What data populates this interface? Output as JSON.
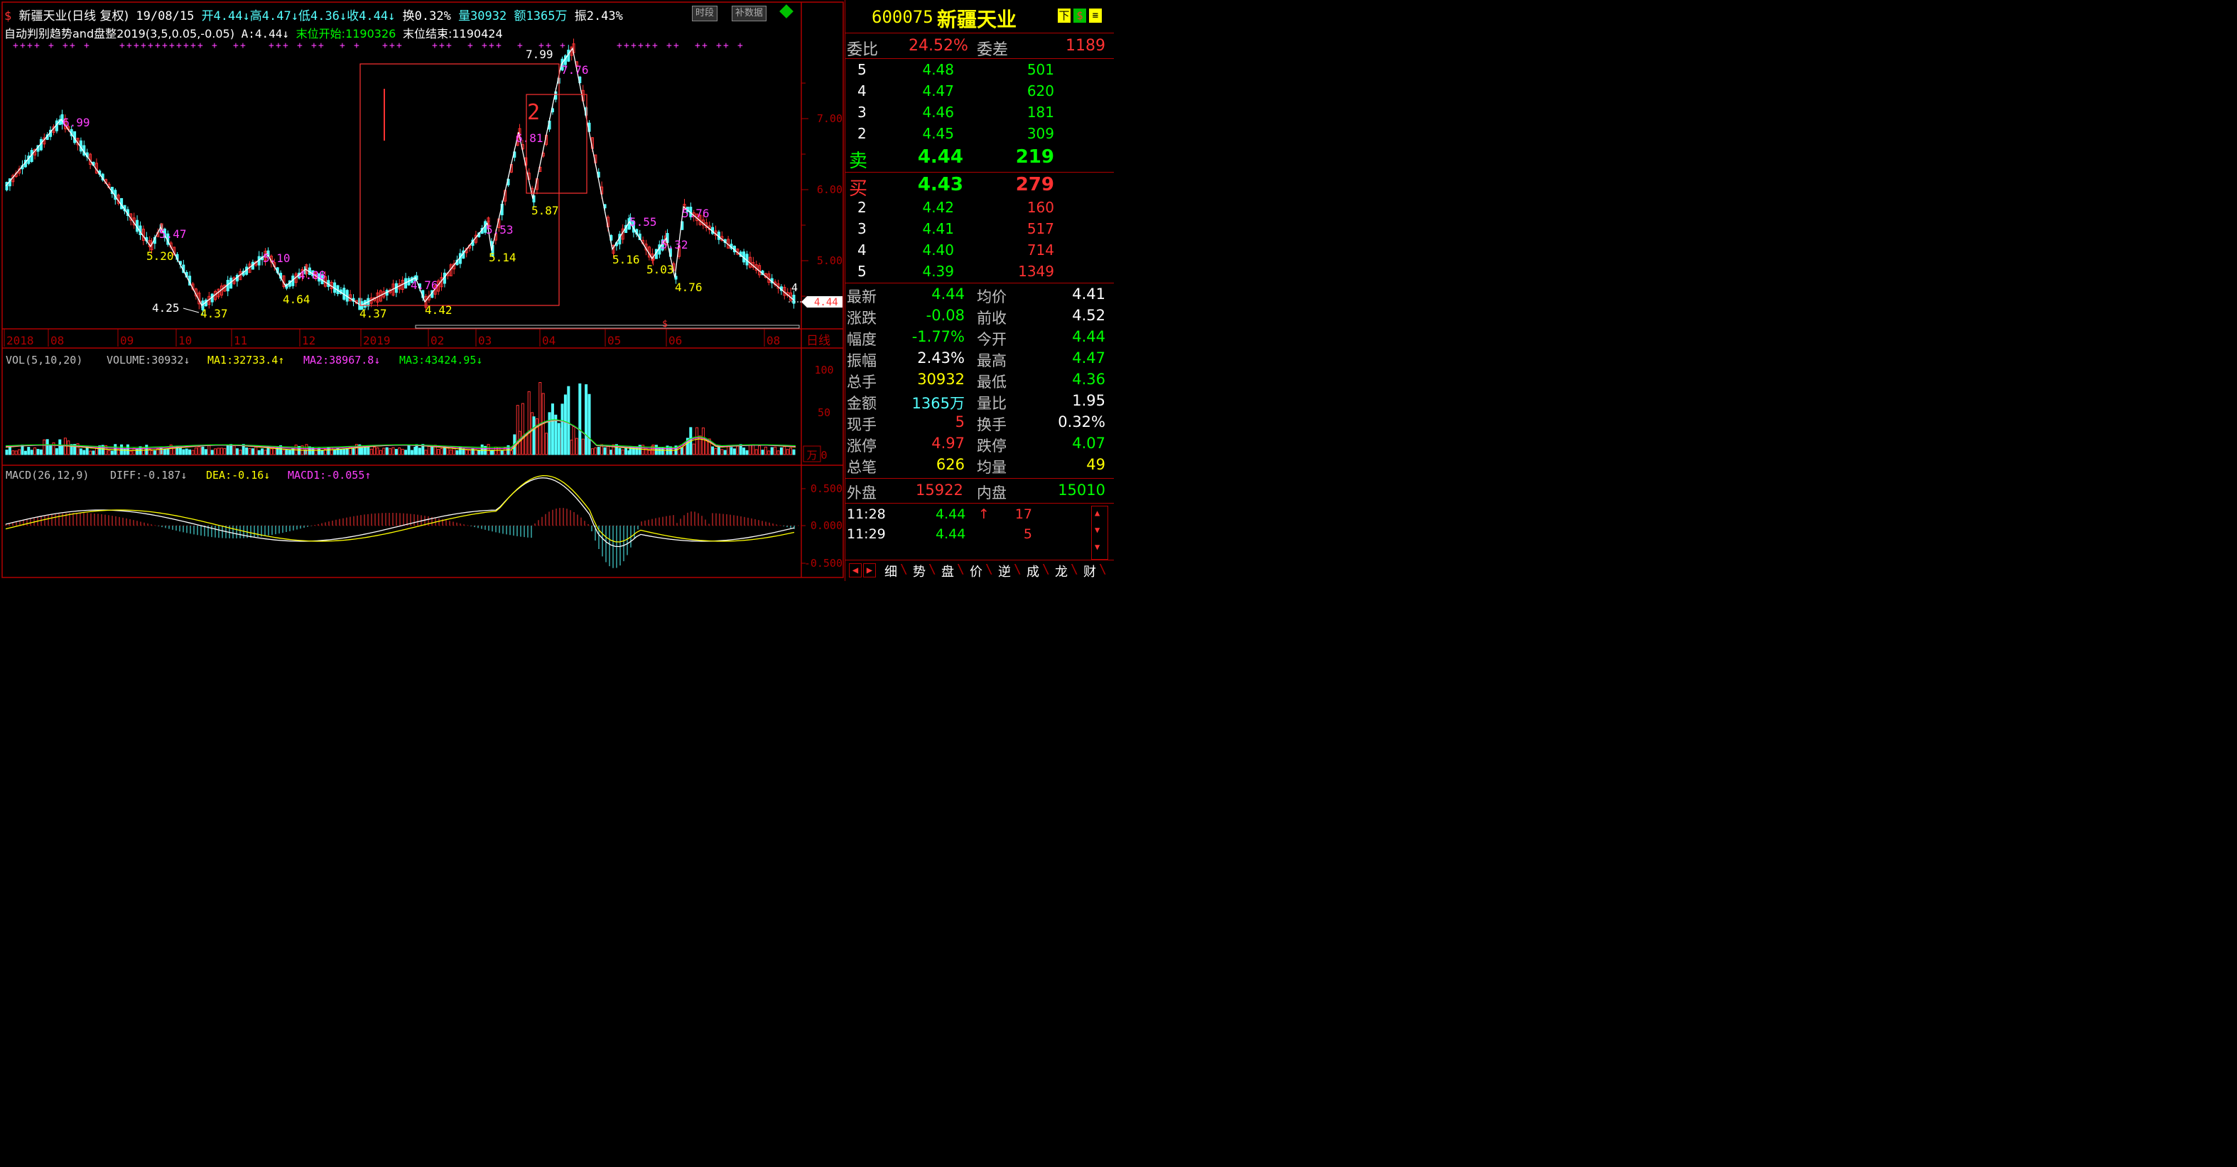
{
  "header": {
    "name": "新疆天业",
    "mode": "(日线 复权)",
    "date": "19/08/15",
    "open": "开4.44",
    "high": "高4.47",
    "low": "低4.36",
    "close": "收4.44",
    "turnover": "换0.32%",
    "volume": "量30932",
    "amount": "额1365万",
    "amplitude": "振2.43%",
    "btn_time": "时段",
    "btn_supp": "补数据",
    "line2_a": "自动判别趋势and盘整2019(3,5,0.05,-0.05)",
    "line2_b": "A:4.44",
    "line2_c": "末位开始:1190326",
    "line2_d": "末位结束:1190424"
  },
  "colors": {
    "up": "#ff3232",
    "down": "#54ffff",
    "magenta": "#ff40ff",
    "yellow": "#ffff00",
    "white": "#ffffff",
    "grid": "#b00000"
  },
  "chart_data": [
    {
      "type": "candlestick",
      "title": "新疆天业 (日线 复权)",
      "price_axis": [
        5.0,
        6.0,
        7.0
      ],
      "last_price": "4.44",
      "period_label": "日线",
      "months": [
        "2018",
        "08",
        "09",
        "10",
        "11",
        "12",
        "2019",
        "02",
        "03",
        "04",
        "05",
        "06",
        "08"
      ],
      "zigzag": [
        {
          "date": "2018-07",
          "price": 6.05
        },
        {
          "date": "2018-08",
          "price": 6.99,
          "label": "6.99"
        },
        {
          "date": "2018-09",
          "price": 5.2,
          "label": "5.20"
        },
        {
          "date": "2018-09",
          "price": 5.47,
          "label": "5.47"
        },
        {
          "date": "2018-10",
          "price": 4.37,
          "label": "4.37"
        },
        {
          "date": "2018-11",
          "price": 5.1,
          "label": "5.10"
        },
        {
          "date": "2018-11",
          "price": 4.64,
          "label": "4.64"
        },
        {
          "date": "2018-12",
          "price": 4.88,
          "label": "4.88"
        },
        {
          "date": "2019-01",
          "price": 4.37,
          "label": "4.37"
        },
        {
          "date": "2019-01",
          "price": 4.76,
          "label": "4.76"
        },
        {
          "date": "2019-02",
          "price": 4.42,
          "label": "4.42"
        },
        {
          "date": "2019-03",
          "price": 5.53,
          "label": "5.53"
        },
        {
          "date": "2019-03",
          "price": 5.14,
          "label": "5.14"
        },
        {
          "date": "2019-03",
          "price": 6.81,
          "label": "6.81"
        },
        {
          "date": "2019-04",
          "price": 5.87,
          "label": "5.87"
        },
        {
          "date": "2019-04",
          "price": 7.76,
          "label": "7.76"
        },
        {
          "date": "2019-04",
          "price": 7.99,
          "label": "7.99"
        },
        {
          "date": "2019-05",
          "price": 5.16,
          "label": "5.16"
        },
        {
          "date": "2019-05",
          "price": 5.55,
          "label": "5.55"
        },
        {
          "date": "2019-06",
          "price": 5.03,
          "label": "5.03"
        },
        {
          "date": "2019-06",
          "price": 5.32,
          "label": "5.32"
        },
        {
          "date": "2019-06",
          "price": 4.76,
          "label": "4.76"
        },
        {
          "date": "2019-06",
          "price": 5.76,
          "label": "5.76"
        },
        {
          "date": "2019-08",
          "price": 4.44
        }
      ],
      "annotations": [
        "4.25",
        "2",
        "4"
      ]
    },
    {
      "type": "bar",
      "title": "VOL(5,10,20)",
      "legend": [
        "VOLUME:30932",
        "MA1:32733.4",
        "MA2:38967.8",
        "MA3:43424.95"
      ],
      "axis": [
        "100",
        "50",
        "0"
      ],
      "unit": "万"
    },
    {
      "type": "bar",
      "title": "MACD(26,12,9)",
      "legend": [
        "DIFF:-0.187",
        "DEA:-0.16",
        "MACD1:-0.055"
      ],
      "axis": [
        "0.500",
        "0.000",
        "-0.500"
      ]
    }
  ],
  "panel": {
    "code": "600075",
    "name": "新疆天业",
    "btn_down": "下",
    "btn_dollar": "$",
    "weibi_label": "委比",
    "weibi": "24.52%",
    "weicha_label": "委差",
    "weicha": "1189",
    "sell": [
      {
        "lv": "5",
        "p": "4.48",
        "v": "501"
      },
      {
        "lv": "4",
        "p": "4.47",
        "v": "620"
      },
      {
        "lv": "3",
        "p": "4.46",
        "v": "181"
      },
      {
        "lv": "2",
        "p": "4.45",
        "v": "309"
      },
      {
        "lv": "卖",
        "p": "4.44",
        "v": "219"
      }
    ],
    "buy": [
      {
        "lv": "买",
        "p": "4.43",
        "v": "279"
      },
      {
        "lv": "2",
        "p": "4.42",
        "v": "160"
      },
      {
        "lv": "3",
        "p": "4.41",
        "v": "517"
      },
      {
        "lv": "4",
        "p": "4.40",
        "v": "714"
      },
      {
        "lv": "5",
        "p": "4.39",
        "v": "1349"
      }
    ],
    "stats": [
      {
        "l": "最新",
        "v": "4.44",
        "c": "#00ff00",
        "l2": "均价",
        "v2": "4.41",
        "c2": "#ffffff"
      },
      {
        "l": "涨跌",
        "v": "-0.08",
        "c": "#00ff00",
        "l2": "前收",
        "v2": "4.52",
        "c2": "#ffffff"
      },
      {
        "l": "幅度",
        "v": "-1.77%",
        "c": "#00ff00",
        "l2": "今开",
        "v2": "4.44",
        "c2": "#00ff00"
      },
      {
        "l": "振幅",
        "v": "2.43%",
        "c": "#ffffff",
        "l2": "最高",
        "v2": "4.47",
        "c2": "#00ff00"
      },
      {
        "l": "总手",
        "v": "30932",
        "c": "#ffff00",
        "l2": "最低",
        "v2": "4.36",
        "c2": "#00ff00"
      },
      {
        "l": "金额",
        "v": "1365万",
        "c": "#54ffff",
        "l2": "量比",
        "v2": "1.95",
        "c2": "#ffffff"
      },
      {
        "l": "现手",
        "v": "5",
        "c": "#ff3232",
        "l2": "换手",
        "v2": "0.32%",
        "c2": "#ffffff"
      },
      {
        "l": "涨停",
        "v": "4.97",
        "c": "#ff3232",
        "l2": "跌停",
        "v2": "4.07",
        "c2": "#00ff00"
      },
      {
        "l": "总笔",
        "v": "626",
        "c": "#ffff00",
        "l2": "均量",
        "v2": "49",
        "c2": "#ffff00"
      }
    ],
    "outer_label": "外盘",
    "outer": "15922",
    "inner_label": "内盘",
    "inner": "15010",
    "ticks": [
      {
        "t": "11:28",
        "p": "4.44",
        "arrow": "↑",
        "v": "17"
      },
      {
        "t": "11:29",
        "p": "4.44",
        "arrow": "",
        "v": "5"
      }
    ],
    "tabs": [
      "细",
      "势",
      "盘",
      "价",
      "逆",
      "成",
      "龙",
      "财"
    ]
  }
}
